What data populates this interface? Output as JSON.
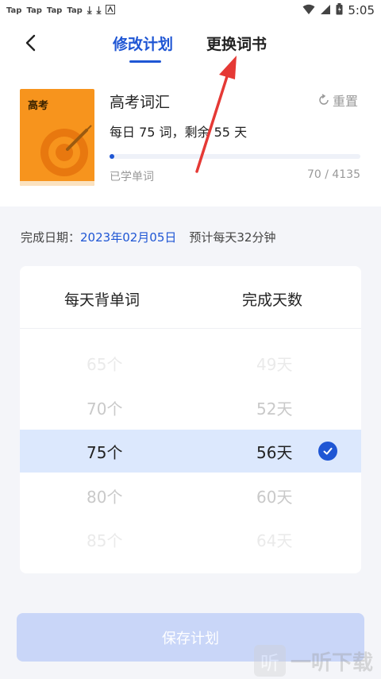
{
  "status_bar": {
    "notification_labels": [
      "Tap",
      "Tap",
      "Tap",
      "Tap"
    ],
    "time": "5:05"
  },
  "header": {
    "back_icon": "chevron-left-icon",
    "tabs": [
      {
        "label": "修改计划",
        "active": true
      },
      {
        "label": "更换词书",
        "active": false
      }
    ]
  },
  "book": {
    "cover_title": "高考",
    "name": "高考词汇",
    "reset_label": "重置",
    "plan_text": "每日 75 词，剩余 55 天",
    "progress": 0.017,
    "learned_label": "已学单词",
    "learned_count": "70 / 4135"
  },
  "completion": {
    "label": "完成日期：",
    "date": "2023年02月05日",
    "estimate": "预计每天32分钟"
  },
  "picker": {
    "column_words": "每天背单词",
    "column_days": "完成天数",
    "options": [
      {
        "words": "65个",
        "days": "49天"
      },
      {
        "words": "70个",
        "days": "52天"
      },
      {
        "words": "75个",
        "days": "56天",
        "selected": true
      },
      {
        "words": "80个",
        "days": "60天"
      },
      {
        "words": "85个",
        "days": "64天"
      }
    ]
  },
  "save_button": "保存计划",
  "watermark": {
    "badge": "听",
    "text": "一听下载"
  },
  "colors": {
    "accent": "#1f56d4",
    "book_cover": "#f7941d",
    "selected_row": "#dce8fd",
    "save_button_disabled": "#c9d6f8",
    "annotation_arrow": "#e53935"
  }
}
